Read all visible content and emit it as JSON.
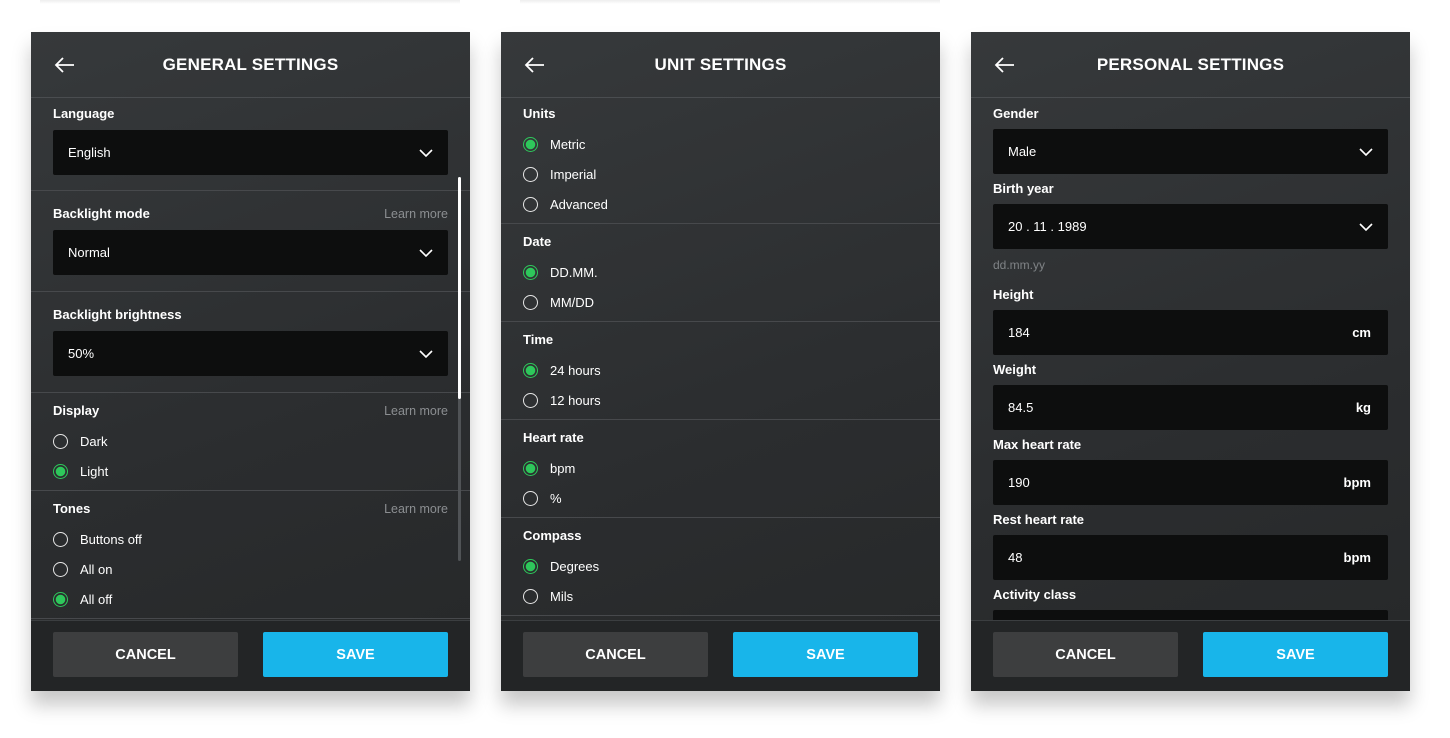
{
  "colors": {
    "accent": "#18b5ea",
    "radio_selected": "#2ec85b",
    "panel_bg": "#2e3032",
    "input_bg": "#0d0e0e"
  },
  "icons": {
    "back": "arrow-left-icon",
    "dropdown": "chevron-down-icon"
  },
  "panels": [
    {
      "id": "general",
      "title": "GENERAL SETTINGS",
      "cancel": "CANCEL",
      "save": "SAVE",
      "scrollbar": true,
      "sections": [
        {
          "type": "select",
          "label": "Language",
          "value": "English"
        },
        {
          "type": "select",
          "label": "Backlight mode",
          "learn_more": "Learn more",
          "value": "Normal"
        },
        {
          "type": "select",
          "label": "Backlight brightness",
          "value": "50%"
        },
        {
          "type": "radio",
          "label": "Display",
          "learn_more": "Learn more",
          "options": [
            "Dark",
            "Light"
          ],
          "selected": 1
        },
        {
          "type": "radio",
          "label": "Tones",
          "learn_more": "Learn more",
          "options": [
            "Buttons off",
            "All on",
            "All off"
          ],
          "selected": 2
        }
      ]
    },
    {
      "id": "unit",
      "title": "UNIT SETTINGS",
      "cancel": "CANCEL",
      "save": "SAVE",
      "sections": [
        {
          "type": "radio",
          "label": "Units",
          "options": [
            "Metric",
            "Imperial",
            "Advanced"
          ],
          "selected": 0
        },
        {
          "type": "radio",
          "label": "Date",
          "options": [
            "DD.MM.",
            "MM/DD"
          ],
          "selected": 0
        },
        {
          "type": "radio",
          "label": "Time",
          "options": [
            "24 hours",
            "12 hours"
          ],
          "selected": 0
        },
        {
          "type": "radio",
          "label": "Heart rate",
          "options": [
            "bpm",
            "%"
          ],
          "selected": 0
        },
        {
          "type": "radio",
          "label": "Compass",
          "options": [
            "Degrees",
            "Mils"
          ],
          "selected": 0
        }
      ]
    },
    {
      "id": "personal",
      "title": "PERSONAL SETTINGS",
      "cancel": "CANCEL",
      "save": "SAVE",
      "fields": [
        {
          "type": "select",
          "label": "Gender",
          "value": "Male"
        },
        {
          "type": "select",
          "label": "Birth year",
          "value": "20 . 11 . 1989",
          "hint": "dd.mm.yy"
        },
        {
          "type": "input",
          "label": "Height",
          "value": "184",
          "unit": "cm"
        },
        {
          "type": "input",
          "label": "Weight",
          "value": "84.5",
          "unit": "kg"
        },
        {
          "type": "input",
          "label": "Max heart rate",
          "value": "190",
          "unit": "bpm"
        },
        {
          "type": "input",
          "label": "Rest heart rate",
          "value": "48",
          "unit": "bpm"
        },
        {
          "type": "input",
          "label": "Activity class",
          "value": ""
        }
      ]
    }
  ]
}
